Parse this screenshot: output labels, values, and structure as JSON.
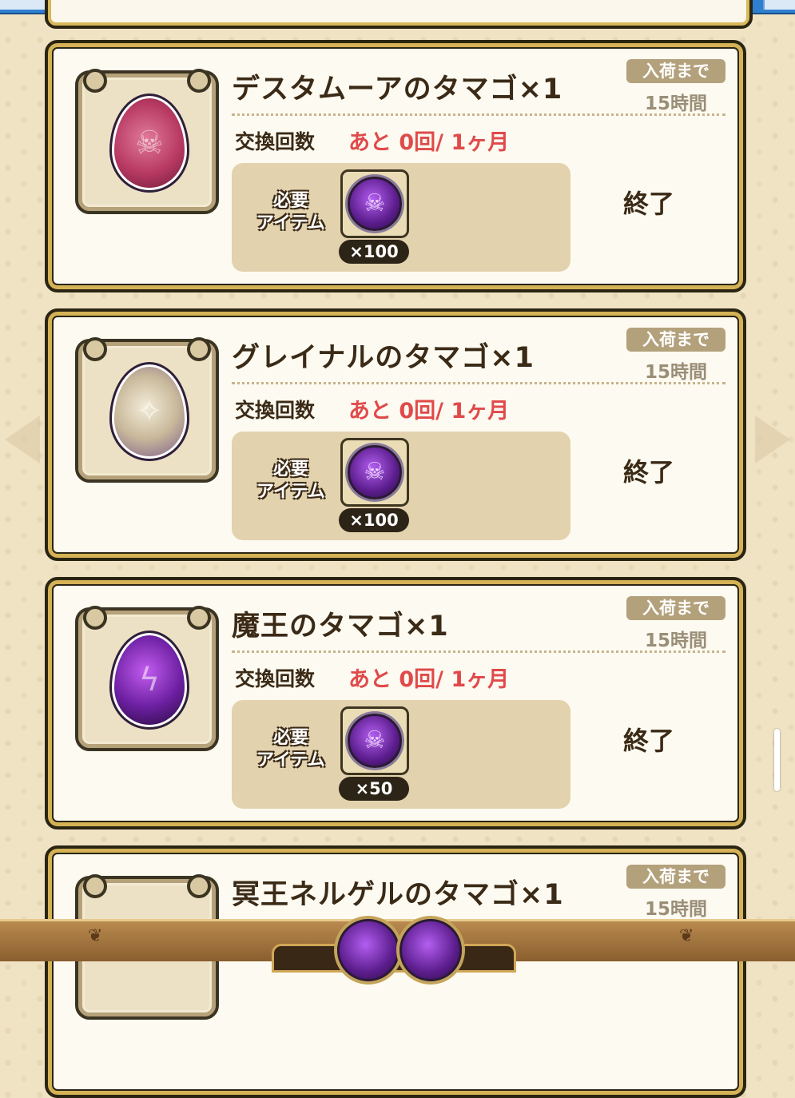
{
  "cards": [
    {
      "title": "デスタムーアのタマゴ×1",
      "arrival_label": "入荷まで",
      "arrival_time": "15時間",
      "exchange_label": "交換回数",
      "remaining": "あと 0回/ 1ヶ月",
      "required_label_line1": "必要",
      "required_label_line2": "アイテム",
      "required_qty": "×100",
      "status": "終了",
      "egg_icon": "desutamua-egg-icon",
      "egg_color": "#b83a63"
    },
    {
      "title": "グレイナルのタマゴ×1",
      "arrival_label": "入荷まで",
      "arrival_time": "15時間",
      "exchange_label": "交換回数",
      "remaining": "あと 0回/ 1ヶ月",
      "required_label_line1": "必要",
      "required_label_line2": "アイテム",
      "required_qty": "×100",
      "status": "終了",
      "egg_icon": "greinal-egg-icon",
      "egg_color": "#c9b99b"
    },
    {
      "title": "魔王のタマゴ×1",
      "arrival_label": "入荷まで",
      "arrival_time": "15時間",
      "exchange_label": "交換回数",
      "remaining": "あと 0回/ 1ヶ月",
      "required_label_line1": "必要",
      "required_label_line2": "アイテム",
      "required_qty": "×50",
      "status": "終了",
      "egg_icon": "maou-egg-icon",
      "egg_color": "#6b1fa0"
    },
    {
      "title": "冥王ネルゲルのタマゴ×1",
      "arrival_label": "入荷まで",
      "arrival_time": "15時間"
    }
  ],
  "colors": {
    "accent_red": "#e04a4a",
    "gold_border": "#d4b255",
    "medal_purple": "#5b1d8c"
  }
}
